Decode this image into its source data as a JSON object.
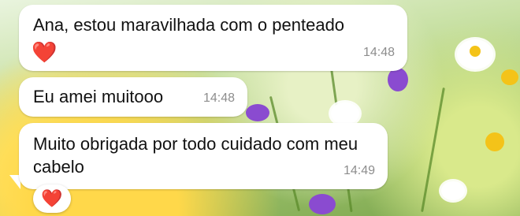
{
  "messages": [
    {
      "text": "Ana, estou maravilhada com o penteado",
      "emoji": "❤️",
      "time": "14:48"
    },
    {
      "text": "Eu amei muitooo",
      "time": "14:48"
    },
    {
      "text": "Muito obrigada por todo cuidado com meu cabelo",
      "time": "14:49",
      "reaction": "❤️"
    }
  ],
  "colors": {
    "bubble": "#ffffff",
    "timestamp": "#8d8d8d",
    "heart": "#e02b2b"
  }
}
